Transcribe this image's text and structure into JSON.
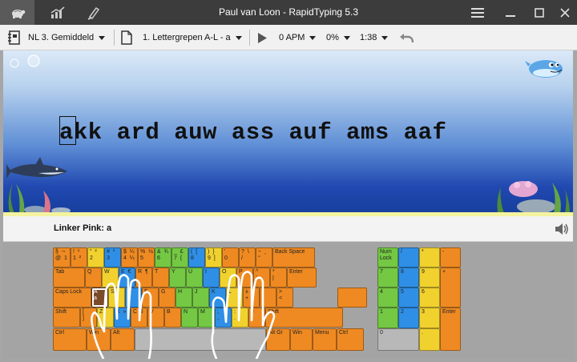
{
  "window": {
    "title": "Paul van Loon - RapidTyping 5.3"
  },
  "titlebar_tabs": [
    {
      "name": "typing-tutor",
      "icon": "turtle-icon"
    },
    {
      "name": "statistics",
      "icon": "bar-chart-icon"
    },
    {
      "name": "editor",
      "icon": "brush-icon"
    }
  ],
  "toolbar": {
    "course": "NL 3. Gemiddeld",
    "lesson": "1. Lettergrepen A-L - a",
    "speed": "0 APM",
    "accuracy": "0%",
    "time": "1:38"
  },
  "lesson": {
    "text": "akk ard auw ass auf ams aaf"
  },
  "hint": {
    "finger": "Linker Pink: a"
  },
  "colors": {
    "orange": "#ef8a22",
    "yellow": "#f1d12e",
    "green": "#74c843",
    "blue": "#2f8fe6",
    "title_bar": "#3c3c3c"
  },
  "keyboard": {
    "row1": [
      {
        "c": "orange",
        "t": "§  ¬\n@  1"
      },
      {
        "c": "orange",
        "t": "!  ¹\n1  ²"
      },
      {
        "c": "yellow",
        "t": "\"  ²\n2"
      },
      {
        "c": "blue",
        "t": "#  ³\n3"
      },
      {
        "c": "orange",
        "t": "$  ¼\n4  ¼"
      },
      {
        "c": "orange",
        "t": "%  ½\n5"
      },
      {
        "c": "green",
        "t": "&  ¾\n6"
      },
      {
        "c": "green",
        "t": "_  £\n7  {"
      },
      {
        "c": "blue",
        "t": "(  [\n8"
      },
      {
        "c": "yellow",
        "t": ")  }\n9  ]"
      },
      {
        "c": "orange",
        "t": "'\n0"
      },
      {
        "c": "orange",
        "t": "?  \\\n/"
      },
      {
        "c": "orange",
        "t": "~  ¸\n°"
      },
      {
        "c": "orange",
        "t": "Back Space"
      }
    ],
    "row2": [
      {
        "c": "orange",
        "t": "Tab"
      },
      {
        "c": "orange",
        "t": "Q"
      },
      {
        "c": "yellow",
        "t": "W"
      },
      {
        "c": "blue",
        "t": "E  €"
      },
      {
        "c": "orange",
        "t": "R  ¶"
      },
      {
        "c": "orange",
        "t": "T"
      },
      {
        "c": "green",
        "t": "Y"
      },
      {
        "c": "green",
        "t": "U"
      },
      {
        "c": "blue",
        "t": "I"
      },
      {
        "c": "yellow",
        "t": "O"
      },
      {
        "c": "orange",
        "t": "P"
      },
      {
        "c": "orange",
        "t": "^\n¨"
      },
      {
        "c": "orange",
        "t": "*\n|"
      },
      {
        "c": "orange",
        "t": "Enter"
      }
    ],
    "row3": [
      {
        "c": "orange",
        "t": "Caps Lock"
      },
      {
        "c": "brown",
        "t": "A\na"
      },
      {
        "c": "yellow",
        "t": "S"
      },
      {
        "c": "blue",
        "t": "D"
      },
      {
        "c": "orange",
        "t": "F"
      },
      {
        "c": "orange",
        "t": "G"
      },
      {
        "c": "green",
        "t": "H"
      },
      {
        "c": "green",
        "t": "J"
      },
      {
        "c": "blue",
        "t": "K"
      },
      {
        "c": "yellow",
        "t": "L"
      },
      {
        "c": "orange",
        "t": "±\n+"
      },
      {
        "c": "orange",
        "t": "`\n´"
      },
      {
        "c": "orange",
        "t": ">\n<"
      }
    ],
    "row4": [
      {
        "c": "orange",
        "t": "Shift"
      },
      {
        "c": "orange",
        "t": "[\n]"
      },
      {
        "c": "yellow",
        "t": "Z"
      },
      {
        "c": "blue",
        "t": "X  »"
      },
      {
        "c": "orange",
        "t": "C  ¢"
      },
      {
        "c": "orange",
        "t": "V"
      },
      {
        "c": "orange",
        "t": "B"
      },
      {
        "c": "green",
        "t": "N"
      },
      {
        "c": "green",
        "t": "M"
      },
      {
        "c": "blue",
        "t": ";\n,"
      },
      {
        "c": "yellow",
        "t": ":\n."
      },
      {
        "c": "orange",
        "t": "=\n-"
      },
      {
        "c": "orange",
        "t": "Shift"
      }
    ],
    "row5": [
      {
        "c": "orange",
        "t": "Ctrl"
      },
      {
        "c": "orange",
        "t": "Win"
      },
      {
        "c": "orange",
        "t": "Alt"
      },
      {
        "c": "gray",
        "t": ""
      },
      {
        "c": "orange",
        "t": "Alt Gr"
      },
      {
        "c": "orange",
        "t": "Win"
      },
      {
        "c": "orange",
        "t": "Menu"
      },
      {
        "c": "orange",
        "t": "Ctrl"
      }
    ],
    "numpad": [
      {
        "c": "green",
        "t": "Num\nLock"
      },
      {
        "c": "blue",
        "t": "/"
      },
      {
        "c": "yellow",
        "t": "*"
      },
      {
        "c": "orange",
        "t": "-"
      },
      {
        "c": "green",
        "t": "7"
      },
      {
        "c": "blue",
        "t": "8"
      },
      {
        "c": "yellow",
        "t": "9"
      },
      {
        "c": "orange",
        "t": "+"
      },
      {
        "c": "green",
        "t": "4"
      },
      {
        "c": "blue",
        "t": "5"
      },
      {
        "c": "yellow",
        "t": "6"
      },
      {
        "c": "green",
        "t": "1"
      },
      {
        "c": "blue",
        "t": "2"
      },
      {
        "c": "yellow",
        "t": "3"
      },
      {
        "c": "orange",
        "t": "Enter"
      },
      {
        "c": "gray",
        "t": "0"
      },
      {
        "c": "yellow",
        "t": "."
      }
    ]
  }
}
